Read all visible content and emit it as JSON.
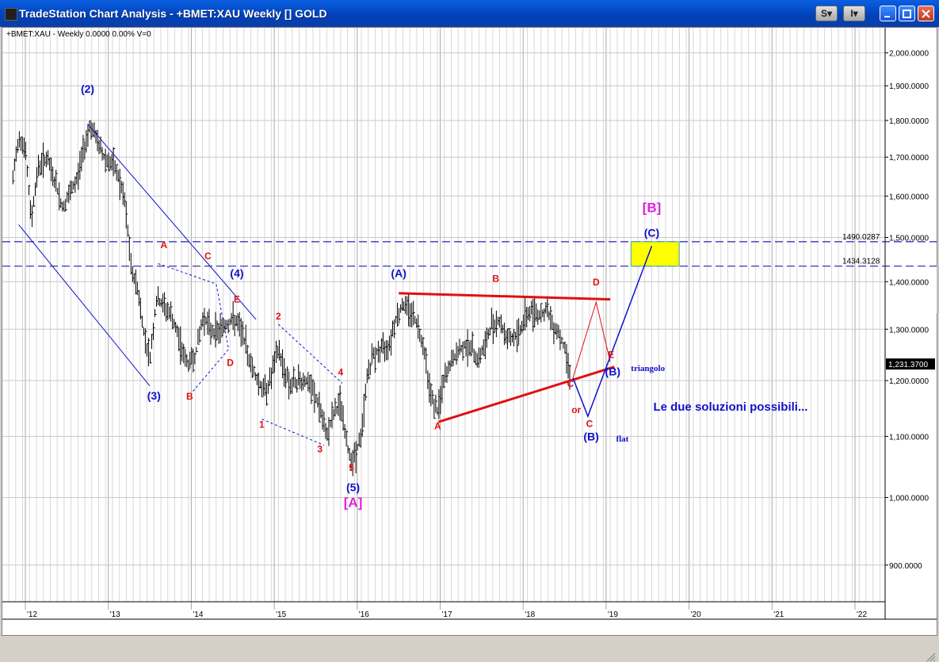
{
  "window": {
    "title": "TradeStation Chart Analysis - +BMET:XAU Weekly [] GOLD",
    "buttons": {
      "s": "S",
      "i": "I"
    }
  },
  "chart_header": "+BMET:XAU - Weekly  0.0000  0.00%  V=0",
  "chart_data": {
    "type": "bar",
    "title": "",
    "ylabel": "",
    "xlabel": "",
    "y_scale": "log",
    "ylim": [
      850,
      2080
    ],
    "xlim": [
      2011.8,
      2022.4
    ],
    "x_ticks": [
      {
        "x": 2012,
        "label": "'12"
      },
      {
        "x": 2013,
        "label": "'13"
      },
      {
        "x": 2014,
        "label": "'14"
      },
      {
        "x": 2015,
        "label": "'15"
      },
      {
        "x": 2016,
        "label": "'16"
      },
      {
        "x": 2017,
        "label": "'17"
      },
      {
        "x": 2018,
        "label": "'18"
      },
      {
        "x": 2019,
        "label": "'19"
      },
      {
        "x": 2020,
        "label": "'20"
      },
      {
        "x": 2021,
        "label": "'21"
      },
      {
        "x": 2022,
        "label": "'22"
      }
    ],
    "y_ticks": [
      {
        "value": 900,
        "label": "900.0000"
      },
      {
        "value": 1000,
        "label": "1,000.0000"
      },
      {
        "value": 1100,
        "label": "1,100.0000"
      },
      {
        "value": 1200,
        "label": "1,200.0000"
      },
      {
        "value": 1300,
        "label": "1,300.0000"
      },
      {
        "value": 1400,
        "label": "1,400.0000"
      },
      {
        "value": 1500,
        "label": "1,500.0000"
      },
      {
        "value": 1600,
        "label": "1,600.0000"
      },
      {
        "value": 1700,
        "label": "1,700.0000"
      },
      {
        "value": 1800,
        "label": "1,800.0000"
      },
      {
        "value": 1900,
        "label": "1,900.0000"
      },
      {
        "value": 2000,
        "label": "2,000.0000"
      }
    ],
    "grid": true,
    "last_price": {
      "value": 1231.37,
      "label": "1,231.3700"
    },
    "price_anchors": [
      [
        2011.85,
        1640
      ],
      [
        2011.92,
        1760
      ],
      [
        2012.0,
        1720
      ],
      [
        2012.07,
        1540
      ],
      [
        2012.15,
        1670
      ],
      [
        2012.25,
        1700
      ],
      [
        2012.35,
        1640
      ],
      [
        2012.45,
        1570
      ],
      [
        2012.55,
        1610
      ],
      [
        2012.62,
        1640
      ],
      [
        2012.7,
        1720
      ],
      [
        2012.78,
        1790
      ],
      [
        2012.85,
        1750
      ],
      [
        2012.95,
        1700
      ],
      [
        2013.05,
        1680
      ],
      [
        2013.12,
        1650
      ],
      [
        2013.2,
        1580
      ],
      [
        2013.28,
        1420
      ],
      [
        2013.35,
        1390
      ],
      [
        2013.42,
        1300
      ],
      [
        2013.5,
        1240
      ],
      [
        2013.58,
        1360
      ],
      [
        2013.66,
        1350
      ],
      [
        2013.75,
        1330
      ],
      [
        2013.85,
        1280
      ],
      [
        2013.95,
        1230
      ],
      [
        2014.05,
        1250
      ],
      [
        2014.15,
        1330
      ],
      [
        2014.22,
        1300
      ],
      [
        2014.3,
        1295
      ],
      [
        2014.42,
        1310
      ],
      [
        2014.52,
        1320
      ],
      [
        2014.62,
        1290
      ],
      [
        2014.7,
        1240
      ],
      [
        2014.8,
        1200
      ],
      [
        2014.88,
        1180
      ],
      [
        2014.95,
        1200
      ],
      [
        2015.05,
        1260
      ],
      [
        2015.12,
        1220
      ],
      [
        2015.2,
        1190
      ],
      [
        2015.3,
        1200
      ],
      [
        2015.38,
        1200
      ],
      [
        2015.46,
        1180
      ],
      [
        2015.55,
        1150
      ],
      [
        2015.62,
        1100
      ],
      [
        2015.72,
        1140
      ],
      [
        2015.8,
        1160
      ],
      [
        2015.88,
        1080
      ],
      [
        2015.95,
        1060
      ],
      [
        2016.05,
        1100
      ],
      [
        2016.12,
        1210
      ],
      [
        2016.2,
        1250
      ],
      [
        2016.3,
        1260
      ],
      [
        2016.38,
        1270
      ],
      [
        2016.46,
        1320
      ],
      [
        2016.55,
        1350
      ],
      [
        2016.65,
        1340
      ],
      [
        2016.72,
        1310
      ],
      [
        2016.8,
        1270
      ],
      [
        2016.88,
        1180
      ],
      [
        2016.96,
        1140
      ],
      [
        2017.05,
        1200
      ],
      [
        2017.12,
        1230
      ],
      [
        2017.2,
        1250
      ],
      [
        2017.3,
        1270
      ],
      [
        2017.38,
        1260
      ],
      [
        2017.46,
        1240
      ],
      [
        2017.55,
        1270
      ],
      [
        2017.62,
        1310
      ],
      [
        2017.7,
        1320
      ],
      [
        2017.78,
        1290
      ],
      [
        2017.86,
        1280
      ],
      [
        2017.94,
        1290
      ],
      [
        2018.04,
        1330
      ],
      [
        2018.12,
        1340
      ],
      [
        2018.2,
        1330
      ],
      [
        2018.28,
        1340
      ],
      [
        2018.36,
        1310
      ],
      [
        2018.44,
        1290
      ],
      [
        2018.52,
        1250
      ],
      [
        2018.58,
        1205
      ]
    ],
    "wave_labels": [
      {
        "text": "(2)",
        "x": 2012.75,
        "y": 1880,
        "color": "blue"
      },
      {
        "text": "(3)",
        "x": 2013.55,
        "y": 1165,
        "color": "blue"
      },
      {
        "text": "(4)",
        "x": 2014.55,
        "y": 1410,
        "color": "blue"
      },
      {
        "text": "(5)",
        "x": 2015.95,
        "y": 1010,
        "color": "blue"
      },
      {
        "text": "[A]",
        "x": 2015.95,
        "y": 985,
        "color": "magenta"
      },
      {
        "text": "(A)",
        "x": 2016.5,
        "y": 1410,
        "color": "blue"
      },
      {
        "text": "A",
        "x": 2013.67,
        "y": 1475,
        "color": "red"
      },
      {
        "text": "C",
        "x": 2014.2,
        "y": 1450,
        "color": "red"
      },
      {
        "text": "E",
        "x": 2014.55,
        "y": 1355,
        "color": "red"
      },
      {
        "text": "B",
        "x": 2013.98,
        "y": 1165,
        "color": "red"
      },
      {
        "text": "D",
        "x": 2014.47,
        "y": 1228,
        "color": "red"
      },
      {
        "text": "2",
        "x": 2015.05,
        "y": 1320,
        "color": "red"
      },
      {
        "text": "4",
        "x": 2015.8,
        "y": 1210,
        "color": "red"
      },
      {
        "text": "1",
        "x": 2014.85,
        "y": 1115,
        "color": "red"
      },
      {
        "text": "3",
        "x": 2015.55,
        "y": 1073,
        "color": "red"
      },
      {
        "text": "5",
        "x": 2015.93,
        "y": 1042,
        "color": "red"
      },
      {
        "text": "A",
        "x": 2016.97,
        "y": 1112,
        "color": "red"
      },
      {
        "text": "B",
        "x": 2017.67,
        "y": 1400,
        "color": "red"
      },
      {
        "text": "C",
        "x": 2018.57,
        "y": 1188,
        "color": "red"
      },
      {
        "text": "D",
        "x": 2018.88,
        "y": 1392,
        "color": "red"
      },
      {
        "text": "E",
        "x": 2019.06,
        "y": 1243,
        "color": "red"
      },
      {
        "text": "or",
        "x": 2018.64,
        "y": 1141,
        "color": "red"
      },
      {
        "text": "C",
        "x": 2018.8,
        "y": 1116,
        "color": "red"
      },
      {
        "text": "(B)",
        "x": 2019.08,
        "y": 1210,
        "color": "blue"
      },
      {
        "text": "(B)",
        "x": 2018.82,
        "y": 1093,
        "color": "blue"
      },
      {
        "text": "(C)",
        "x": 2019.55,
        "y": 1502,
        "color": "blue"
      },
      {
        "text": "[B]",
        "x": 2019.55,
        "y": 1560,
        "color": "magenta"
      }
    ],
    "annotations": [
      {
        "text": "triangolo",
        "x": 2019.3,
        "y": 1218
      },
      {
        "text": "flat",
        "x": 2019.12,
        "y": 1091
      },
      {
        "text": "Le due soluzioni possibili...",
        "x": 2020.5,
        "y": 1145
      }
    ],
    "hlines": [
      {
        "value": 1490.0287,
        "label": "1490.0287"
      },
      {
        "value": 1434.3128,
        "label": "1434.3128"
      }
    ],
    "target_box": {
      "x1": 2019.3,
      "x2": 2019.88,
      "y1": 1434.3128,
      "y2": 1490.0287,
      "color": "#ffff00"
    },
    "lines": [
      {
        "pts": [
          [
            2011.92,
            1530
          ],
          [
            2013.5,
            1190
          ]
        ],
        "color": "blue",
        "dash": false
      },
      {
        "pts": [
          [
            2012.75,
            1790
          ],
          [
            2014.78,
            1320
          ]
        ],
        "color": "blue",
        "dash": false
      },
      {
        "pts": [
          [
            2013.6,
            1440
          ],
          [
            2014.3,
            1395
          ],
          [
            2014.45,
            1260
          ],
          [
            2014.02,
            1180
          ]
        ],
        "color": "blue",
        "dash": true
      },
      {
        "pts": [
          [
            2015.05,
            1310
          ],
          [
            2015.82,
            1195
          ]
        ],
        "color": "blue",
        "dash": true
      },
      {
        "pts": [
          [
            2014.85,
            1130
          ],
          [
            2015.6,
            1085
          ]
        ],
        "color": "blue",
        "dash": true
      },
      {
        "pts": [
          [
            2016.5,
            1375
          ],
          [
            2019.05,
            1362
          ]
        ],
        "color": "red",
        "width": 3
      },
      {
        "pts": [
          [
            2016.98,
            1125
          ],
          [
            2019.1,
            1226
          ]
        ],
        "color": "red",
        "width": 3
      },
      {
        "pts": [
          [
            2018.6,
            1205
          ],
          [
            2018.88,
            1356
          ],
          [
            2019.05,
            1235
          ]
        ],
        "color": "red",
        "width": 1
      },
      {
        "pts": [
          [
            2018.6,
            1205
          ],
          [
            2018.78,
            1135
          ],
          [
            2019.55,
            1480
          ]
        ],
        "color": "blue",
        "width": 1.5
      }
    ]
  }
}
